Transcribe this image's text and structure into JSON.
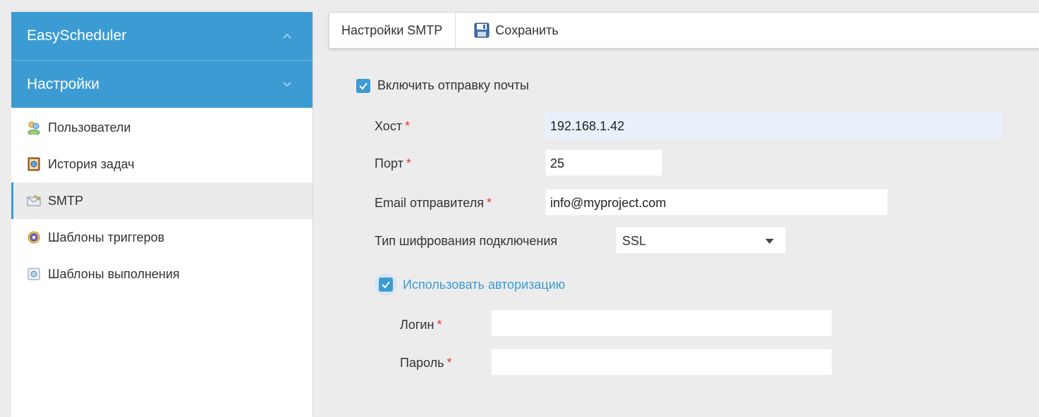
{
  "sidebar": {
    "sections": [
      {
        "label": "EasyScheduler",
        "chevron": "chevron-up-icon"
      },
      {
        "label": "Настройки",
        "chevron": "chevron-down-icon"
      }
    ],
    "items": [
      {
        "label": "Пользователи",
        "icon": "users-icon"
      },
      {
        "label": "История задач",
        "icon": "task-history-icon"
      },
      {
        "label": "SMTP",
        "icon": "mail-icon",
        "active": true
      },
      {
        "label": "Шаблоны триггеров",
        "icon": "trigger-template-icon"
      },
      {
        "label": "Шаблоны выполнения",
        "icon": "execution-template-icon"
      }
    ]
  },
  "toolbar": {
    "title": "Настройки SMTP",
    "save_label": "Сохранить"
  },
  "form": {
    "enable_mail_label": "Включить отправку почты",
    "enable_mail_checked": true,
    "host": {
      "label": "Хост",
      "required_mark": "*",
      "value": "192.168.1.42"
    },
    "port": {
      "label": "Порт",
      "required_mark": "*",
      "value": "25"
    },
    "sender": {
      "label": "Email отправителя",
      "required_mark": "*",
      "value": "info@myproject.com"
    },
    "encryption": {
      "label": "Тип шифрования подключения",
      "value": "SSL"
    },
    "use_auth_label": "Использовать авторизацию",
    "use_auth_checked": true,
    "login": {
      "label": "Логин",
      "required_mark": "*",
      "value": ""
    },
    "password": {
      "label": "Пароль",
      "required_mark": "*",
      "value": ""
    }
  },
  "colors": {
    "accent": "#3d9bd3",
    "required": "#e53935",
    "focused_input": "#e8f1fb"
  }
}
